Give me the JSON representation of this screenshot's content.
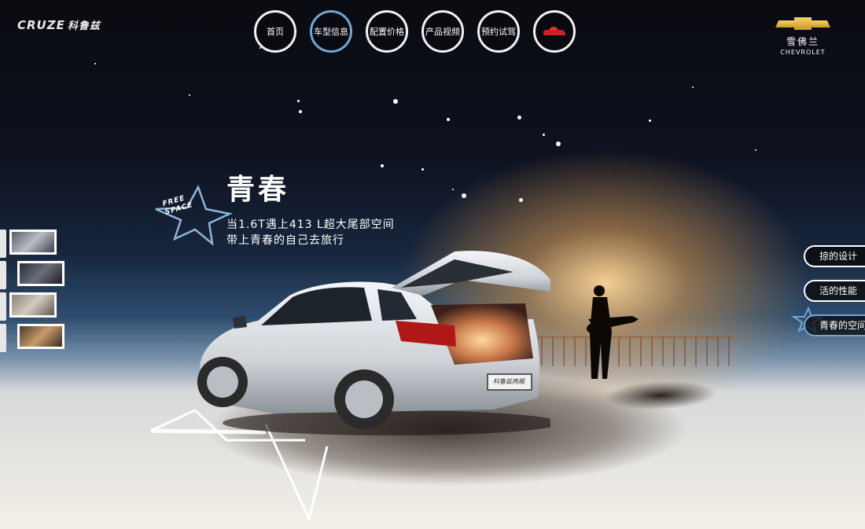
{
  "brand": {
    "model_en": "CRUZE",
    "model_cn": "科鲁兹",
    "maker_cn": "雪佛兰",
    "maker_en": "CHEVROLET"
  },
  "nav": {
    "items": [
      {
        "label": "首页"
      },
      {
        "label": "车型信息",
        "active": true
      },
      {
        "label": "配置价格"
      },
      {
        "label": "产品视频"
      },
      {
        "label": "预约试驾"
      },
      {
        "label": "",
        "icon": "red-car-icon"
      }
    ]
  },
  "hero": {
    "badge_line1": "FREE",
    "badge_line2": "SPACE",
    "title": "青春",
    "tagline_line1": "当1.6T遇上413 L超大尾部空间",
    "tagline_line2": "带上青春的自己去旅行",
    "license_plate": "科鲁兹两厢"
  },
  "side_menu": {
    "items": [
      {
        "label": "掠的设计"
      },
      {
        "label": "活的性能"
      },
      {
        "label": "青春的空间",
        "active": true
      }
    ]
  },
  "thumbnails": [
    {
      "label": "exterior-view"
    },
    {
      "label": "dashboard-view"
    },
    {
      "label": "rear-seat-view"
    },
    {
      "label": "trunk-view"
    }
  ],
  "colors": {
    "accent": "#6fa7d3",
    "gold": "#d8ad3c",
    "car_red": "#c22222"
  }
}
